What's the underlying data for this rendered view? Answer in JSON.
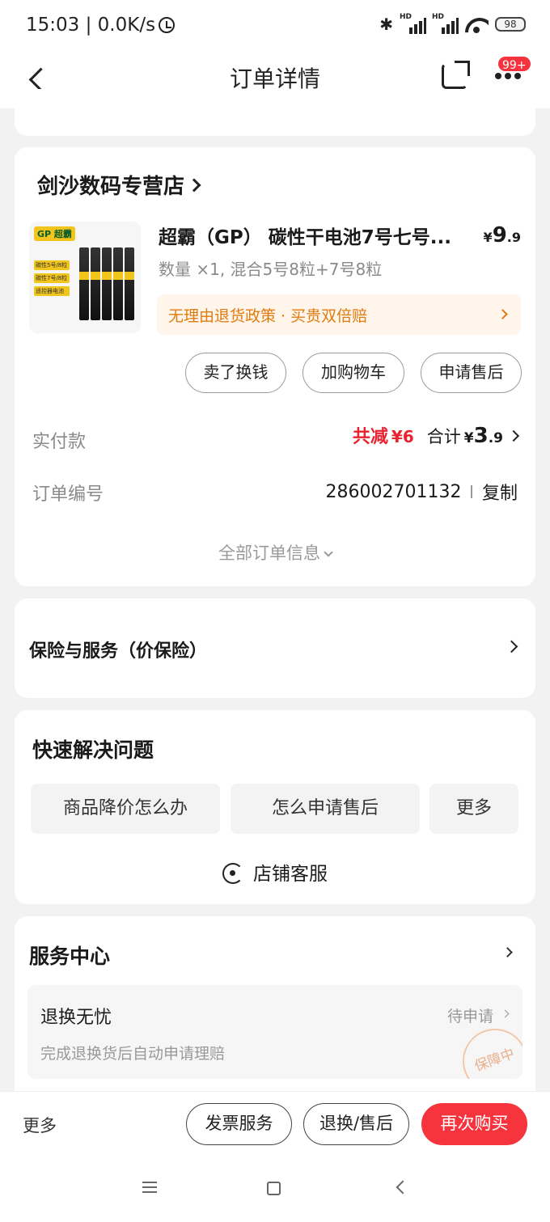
{
  "status_bar": {
    "time": "15:03 | 0.0K/s",
    "battery": "98"
  },
  "nav": {
    "title": "订单详情",
    "badge": "99+"
  },
  "store": {
    "name": "剑沙数码专营店",
    "product": {
      "title": "超霸（GP） 碳性干电池7号七号...",
      "currency": "¥",
      "price_int": "9",
      "price_dec": ".9",
      "spec": "数量 ×1, 混合5号8粒+7号8粒",
      "image_brand": "GP 超霸",
      "image_tags": [
        "碳性5号/8粒",
        "碳性7号/8粒",
        "遥控器电池"
      ],
      "policy": "无理由退货政策 · 买贵双倍赔"
    },
    "actions": [
      "卖了换钱",
      "加购物车",
      "申请售后"
    ],
    "paid_label": "实付款",
    "discount_label": "共减",
    "discount_amount": "¥6",
    "total_label": "合计",
    "total_currency": "¥",
    "total_int": "3",
    "total_dec": ".9",
    "order_no_label": "订单编号",
    "order_no": "286002701132",
    "copy_label": "复制",
    "all_info_label": "全部订单信息"
  },
  "insurance": {
    "label": "保险与服务（价保险）"
  },
  "quick_help": {
    "title": "快速解决问题",
    "buttons": [
      "商品降价怎么办",
      "怎么申请售后",
      "更多"
    ],
    "customer_service": "店铺客服"
  },
  "service_center": {
    "title": "服务中心",
    "item_title": "退换无忧",
    "item_status": "待申请",
    "item_desc": "完成退换货后自动申请理赔",
    "stamp": "保障中"
  },
  "bottom_bar": {
    "more": "更多",
    "invoice": "发票服务",
    "return": "退换/售后",
    "rebuy": "再次购买"
  },
  "colors": {
    "accent_red": "#f5343e",
    "policy_orange": "#e07b10",
    "discount_red": "#e8232f"
  }
}
